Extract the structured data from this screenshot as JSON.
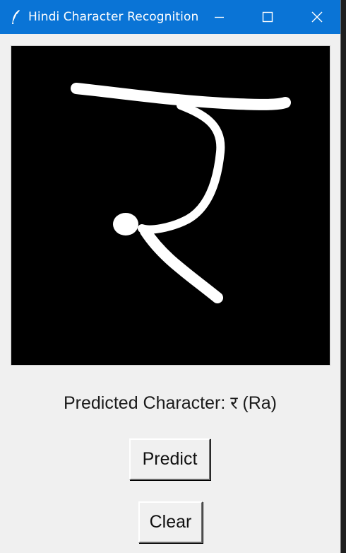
{
  "window": {
    "title": "Hindi Character Recognition",
    "titlebar_color": "#0a74d6",
    "background": "#f0f0f0"
  },
  "icons": {
    "app": "feather-icon",
    "minimize": "minimize-icon",
    "maximize": "maximize-icon",
    "close": "close-icon"
  },
  "canvas": {
    "background": "#000000",
    "stroke_color": "#ffffff"
  },
  "prediction": {
    "text": "Predicted Character: र (Ra)"
  },
  "buttons": {
    "predict_label": "Predict",
    "clear_label": "Clear"
  }
}
